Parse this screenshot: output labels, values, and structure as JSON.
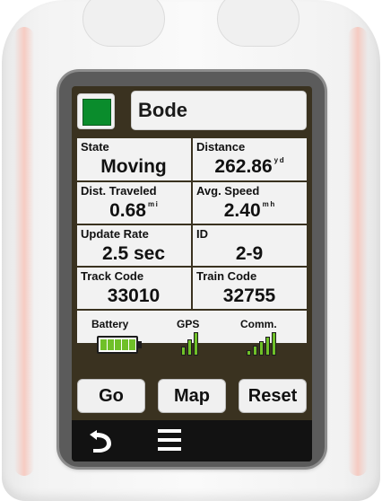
{
  "header": {
    "swatch_color": "#0a8c2c",
    "name": "Bode"
  },
  "fields": [
    {
      "label": "State",
      "value": "Moving",
      "unit": ""
    },
    {
      "label": "Distance",
      "value": "262.86",
      "unit": "y d"
    },
    {
      "label": "Dist. Traveled",
      "value": "0.68",
      "unit": "m i"
    },
    {
      "label": "Avg. Speed",
      "value": "2.40",
      "unit": "m h"
    },
    {
      "label": "Update Rate",
      "value": "2.5 sec",
      "unit": ""
    },
    {
      "label": "ID",
      "value": "2-9",
      "unit": ""
    },
    {
      "label": "Track Code",
      "value": "33010",
      "unit": ""
    },
    {
      "label": "Train Code",
      "value": "32755",
      "unit": ""
    }
  ],
  "status": {
    "battery_label": "Battery",
    "gps_label": "GPS",
    "comm_label": "Comm.",
    "battery_level": 1.0,
    "gps_bars": 3,
    "comm_bars": 5,
    "accent_color": "#6fc028"
  },
  "buttons": {
    "go_label": "Go",
    "map_label": "Map",
    "reset_label": "Reset"
  },
  "nav": {
    "back_icon": "back-arrow-icon",
    "menu_icon": "hamburger-menu-icon"
  }
}
